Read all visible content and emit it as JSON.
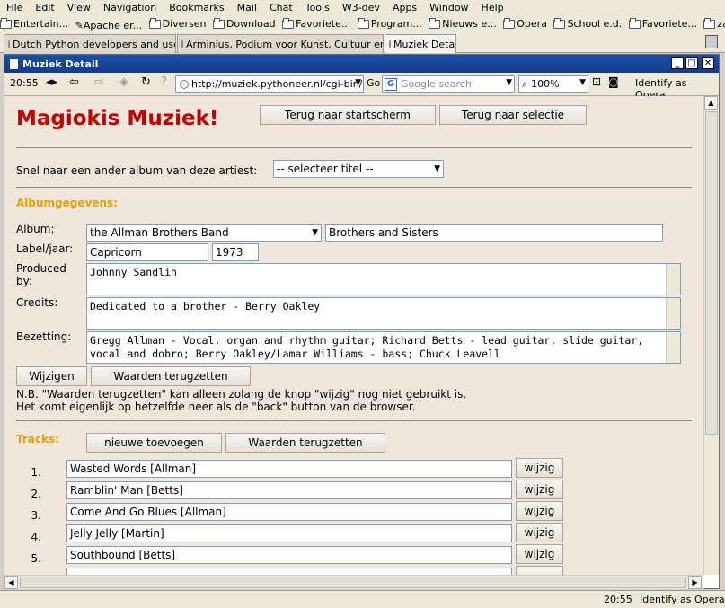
{
  "menu": [
    "File",
    "Edit",
    "View",
    "Navigation",
    "Bookmarks",
    "Mail",
    "Chat",
    "Tools",
    "W3-dev",
    "Apps",
    "Window",
    "Help"
  ],
  "bookmarks": [
    "Entertain...",
    "Apache er...",
    "Diversen",
    "Download",
    "Favoriete...",
    "Program...",
    "Nieuws e...",
    "Opera",
    "School e.d.",
    "Favoriete...",
    "zaken"
  ],
  "tabs": [
    "Dutch Python developers and users",
    "Arminius, Podium voor Kunst, Cultuur en ...",
    "Muziek Detail"
  ],
  "window": {
    "title": "Muziek Detail"
  },
  "toolbar": {
    "time": "20:55",
    "url": "http://muziek.pythoneer.nl/cgi-bin/",
    "go": "Go",
    "search_placeholder": "Google search",
    "zoom": "100%",
    "identify": "Identify as Opera"
  },
  "page": {
    "title": "Magiokis Muziek!",
    "btn_home": "Terug naar startscherm",
    "btn_selection": "Terug naar selectie",
    "quick_label": "Snel naar een ander album van deze artiest:",
    "quick_select": "-- selecteer titel --",
    "album_section": "Albumgegevens:",
    "album_label": "Album:",
    "album_artist": "the Allman Brothers Band",
    "album_title": "Brothers and Sisters",
    "labeljaar_label": "Label/jaar:",
    "label_value": "Capricorn",
    "year_value": "1973",
    "produced_label": "Produced by:",
    "produced_value": "Johnny Sandlin",
    "credits_label": "Credits:",
    "credits_value": "Dedicated to a brother - Berry Oakley",
    "bezetting_label": "Bezetting:",
    "bezetting_value": "Gregg Allman - Vocal, organ and rhythm guitar; Richard Betts - lead guitar, slide guitar, vocal and dobro; Berry Oakley/Lamar Williams - bass; Chuck Leavell",
    "btn_wijzigen": "Wijzigen",
    "btn_reset": "Waarden terugzetten",
    "note1": "N.B. \"Waarden terugzetten\" kan alleen zolang de knop \"wijzig\" nog niet gebruikt is.",
    "note2": "Het komt eigenlijk op hetzelfde neer als de \"back\" button van de browser.",
    "tracks_section": "Tracks:",
    "btn_new": "nieuwe toevoegen",
    "btn_tracks_reset": "Waarden terugzetten",
    "track_button": "wijzig",
    "tracks": [
      {
        "num": "1.",
        "title": "Wasted Words [Allman]"
      },
      {
        "num": "2.",
        "title": "Ramblin' Man [Betts]"
      },
      {
        "num": "3.",
        "title": "Come And Go Blues [Allman]"
      },
      {
        "num": "4.",
        "title": "Jelly Jelly [Martin]"
      },
      {
        "num": "5.",
        "title": "Southbound [Betts]"
      }
    ]
  },
  "status": {
    "time": "20:55",
    "identify": "Identify as Opera"
  }
}
